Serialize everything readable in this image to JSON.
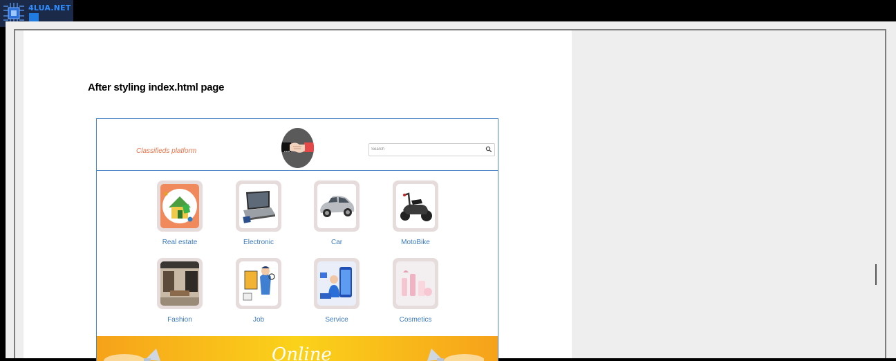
{
  "watermark": {
    "brand": "4LUA.NET"
  },
  "document": {
    "heading": "After styling index.html page"
  },
  "screenshot": {
    "site_title": "Classifieds platform",
    "search": {
      "placeholder": "Search",
      "value": ""
    },
    "categories": [
      {
        "label": "Real estate",
        "icon": "house-icon"
      },
      {
        "label": "Electronic",
        "icon": "laptop-icon"
      },
      {
        "label": "Car",
        "icon": "car-icon"
      },
      {
        "label": "MotoBike",
        "icon": "scooter-icon"
      },
      {
        "label": "Fashion",
        "icon": "store-icon"
      },
      {
        "label": "Job",
        "icon": "job-icon"
      },
      {
        "label": "Service",
        "icon": "phone-service-icon"
      },
      {
        "label": "Cosmetics",
        "icon": "cosmetics-icon"
      }
    ],
    "banner": {
      "word": "Online"
    },
    "colors": {
      "title": "#e8734a",
      "link": "#3c7bc2",
      "border": "#4a86c5",
      "banner": "#f6b81a"
    }
  }
}
